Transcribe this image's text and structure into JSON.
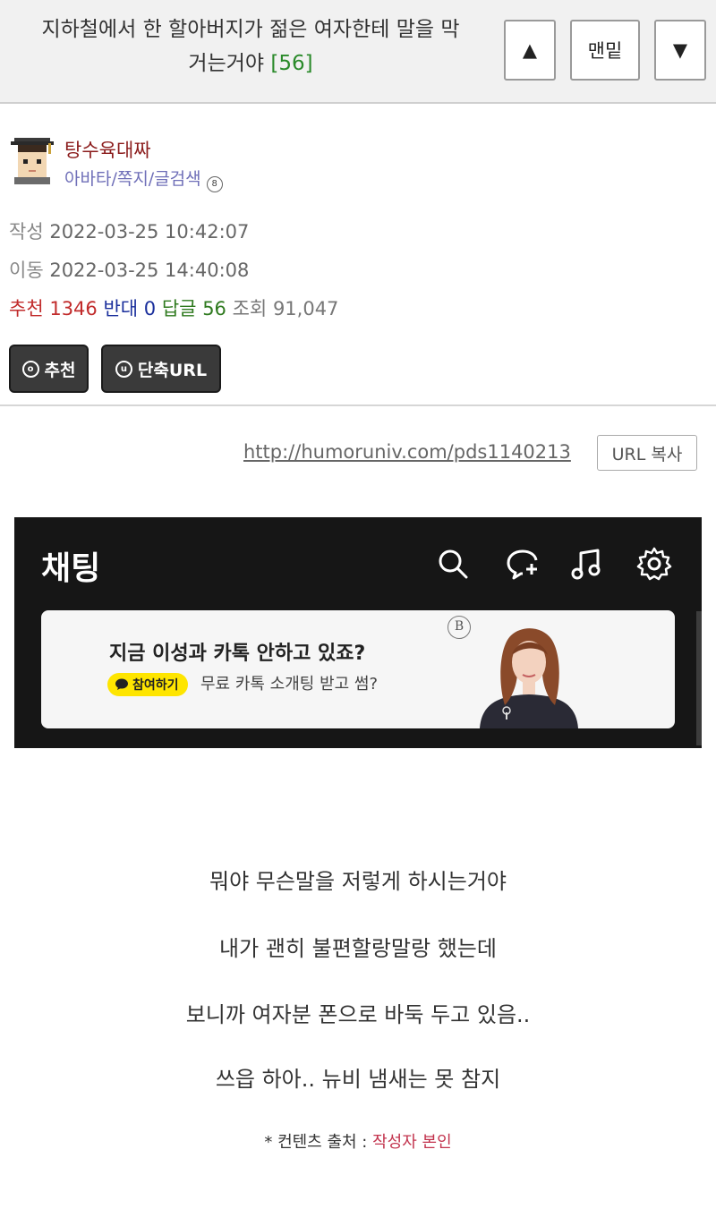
{
  "topbar": {
    "title_line1": "지하철에서 한 할아버지가 젊은 여자한테 말을 막",
    "title_line2": "거는거야",
    "reply_count": "[56]",
    "up_label": "▲",
    "bottom_label": "맨밑",
    "down_label": "▼"
  },
  "author": {
    "name": "탕수육대짜",
    "links": "아바타/쪽지/글검색"
  },
  "meta": {
    "created_label": "작성",
    "created_value": "2022-03-25 10:42:07",
    "moved_label": "이동",
    "moved_value": "2022-03-25 14:40:08",
    "recommend_label": "추천",
    "recommend_value": "1346",
    "oppose_label": "반대",
    "oppose_value": "0",
    "reply_label": "답글",
    "reply_value": "56",
    "views_label": "조회",
    "views_value": "91,047"
  },
  "actions": {
    "recommend_label": "추천",
    "shorturl_label": "단축URL"
  },
  "post_url": {
    "link": "http://humoruniv.com/pds1140213",
    "copy_label": "URL 복사"
  },
  "kakao": {
    "title": "채팅",
    "ad_headline": "지금 이성과 카톡 안하고 있죠?",
    "ad_join": "참여하기",
    "ad_sub": "무료 카톡 소개팅 받고 썸?",
    "ad_logo": "B"
  },
  "story": {
    "line1": "뭐야  무슨말을 저렇게 하시는거야",
    "line2": "내가 괜히 불편할랑말랑 했는데",
    "line3": "보니까 여자분 폰으로 바둑 두고 있음..",
    "line4": "쓰읍 하아.. 뉴비 냄새는 못 참지"
  },
  "source": {
    "prefix": "* 컨텐츠 출처 : ",
    "author": "작성자 본인"
  },
  "colors": {
    "recommend": "#c12b2b",
    "oppose": "#1a2f9c",
    "reply": "#2f7a1f",
    "kakao_yellow": "#fee500"
  }
}
